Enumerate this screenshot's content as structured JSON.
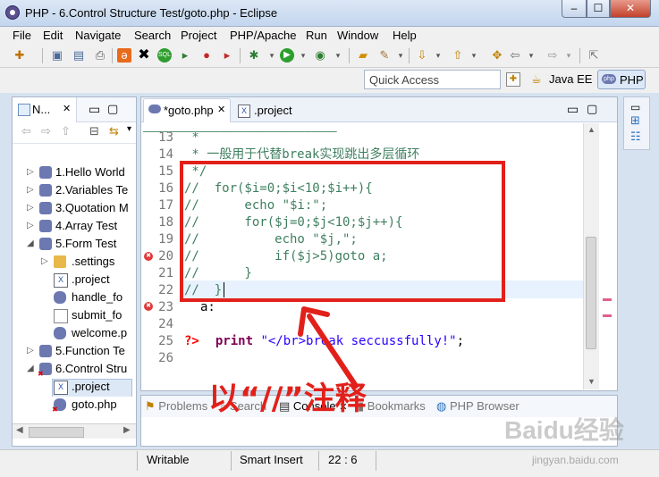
{
  "window": {
    "title": "PHP - 6.Control Structure Test/goto.php - Eclipse",
    "min": "–",
    "max": "☐",
    "close": "✕"
  },
  "menu": [
    "File",
    "Edit",
    "Navigate",
    "Search",
    "Project",
    "PHP/Apache",
    "Run",
    "Window",
    "Help"
  ],
  "quick_access": {
    "placeholder": "Quick Access"
  },
  "perspectives": {
    "javaee": "Java EE",
    "php": "PHP"
  },
  "navigator": {
    "tab_label": "N...",
    "items": [
      {
        "label": "1.Hello World",
        "type": "project",
        "expanded": false
      },
      {
        "label": "2.Variables Te",
        "type": "project",
        "expanded": false
      },
      {
        "label": "3.Quotation M",
        "type": "project",
        "expanded": false
      },
      {
        "label": "4.Array Test",
        "type": "project",
        "expanded": false
      },
      {
        "label": "5.Form Test",
        "type": "project",
        "expanded": true
      },
      {
        "label": ".settings",
        "type": "folder",
        "expanded": false
      },
      {
        "label": ".project",
        "type": "xfile"
      },
      {
        "label": "handle_fo",
        "type": "php"
      },
      {
        "label": "submit_fo",
        "type": "file"
      },
      {
        "label": "welcome.p",
        "type": "php"
      },
      {
        "label": "5.Function Te",
        "type": "project",
        "expanded": false
      },
      {
        "label": "6.Control Stru",
        "type": "project-error",
        "expanded": true
      },
      {
        "label": ".project",
        "type": "xfile",
        "selected": true
      },
      {
        "label": "goto.php",
        "type": "php-error"
      }
    ]
  },
  "editor": {
    "tabs": [
      {
        "label": "*goto.php"
      },
      {
        "label": ".project"
      }
    ],
    "lines": [
      {
        "n": "13",
        "text": " *",
        "cls": "cm"
      },
      {
        "n": "14",
        "text": " * 一般用于代替break实现跳出多层循环",
        "cls": "cm"
      },
      {
        "n": "15",
        "text": " */",
        "cls": "cm"
      },
      {
        "n": "16",
        "text": "//  for($i=0;$i<10;$i++){",
        "cls": "cm"
      },
      {
        "n": "17",
        "text": "//      echo \"$i:\";",
        "cls": "cm"
      },
      {
        "n": "18",
        "text": "//      for($j=0;$j<10;$j++){",
        "cls": "cm"
      },
      {
        "n": "19",
        "text": "//          echo \"$j,\";",
        "cls": "cm"
      },
      {
        "n": "20",
        "text": "//          if($j>5)goto a;",
        "cls": "cm"
      },
      {
        "n": "21",
        "text": "//      }",
        "cls": "cm"
      },
      {
        "n": "22",
        "text": "//  }",
        "cls": "cm"
      },
      {
        "n": "23",
        "text": "a:",
        "cls": ""
      },
      {
        "n": "24",
        "text": "",
        "cls": ""
      },
      {
        "n": "25",
        "text": "?>",
        "cls": "php"
      },
      {
        "n": "26",
        "text": "",
        "cls": ""
      }
    ],
    "line24": {
      "kw": "print",
      "str": "\"</br>break seccussfully!\"",
      "end": ";"
    }
  },
  "bottom_tabs": [
    "Problems",
    "Search",
    "Console",
    "Bookmarks",
    "PHP Browser"
  ],
  "status": {
    "writable": "Writable",
    "insert_mode": "Smart Insert",
    "position": "22 : 6"
  },
  "annotation": {
    "text": "以“//”注释",
    "color": "#e2201a"
  },
  "watermark": {
    "text": "Baidu经验",
    "url": "jingyan.baidu.com"
  }
}
